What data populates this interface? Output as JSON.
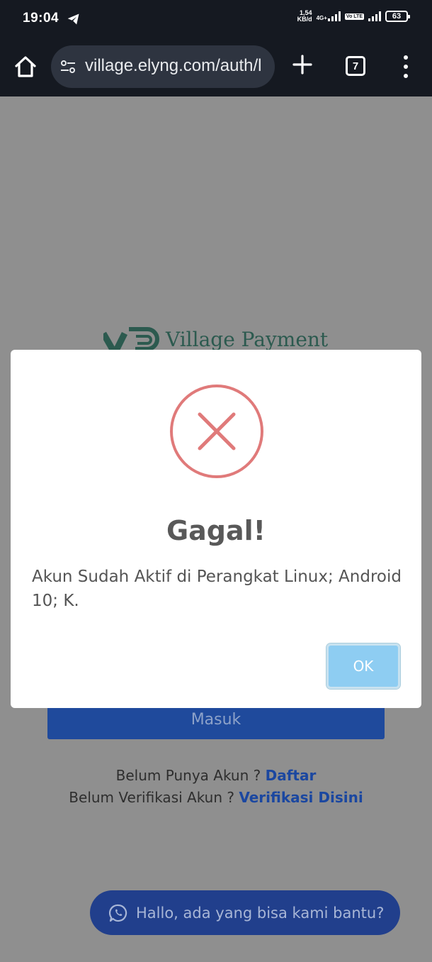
{
  "status_bar": {
    "time": "19:04",
    "net_speed_value": "1,54",
    "net_speed_unit": "KB/d",
    "net_type": "4G+",
    "volte": "Vo LTE",
    "battery": "63"
  },
  "browser": {
    "url": "village.elyng.com/auth/l",
    "tab_count": "7"
  },
  "page": {
    "logo_text": "Village Payment",
    "login_button": "Masuk",
    "register_prompt": "Belum Punya Akun ?",
    "register_link": "Daftar",
    "verify_prompt": "Belum Verifikasi Akun ?",
    "verify_link": "Verifikasi Disini",
    "whatsapp_text": "Hallo, ada yang bisa kami bantu?"
  },
  "modal": {
    "title": "Gagal!",
    "message": "Akun Sudah Aktif di Perangkat Linux; Android 10; K.",
    "ok_button": "OK"
  },
  "colors": {
    "error": "#e07a7a",
    "ok_button": "#8ecdf2",
    "primary": "#1f4a9c"
  }
}
